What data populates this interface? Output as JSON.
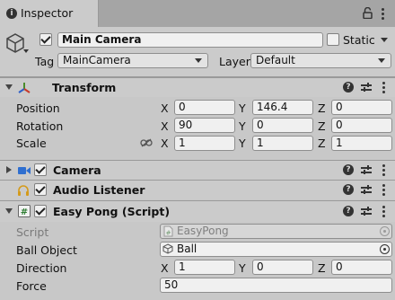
{
  "tab": {
    "label": "Inspector"
  },
  "object": {
    "name": "Main Camera",
    "active": true,
    "static_label": "Static",
    "static_checked": false,
    "tag_label": "Tag",
    "tag_value": "MainCamera",
    "layer_label": "Layer",
    "layer_value": "Default"
  },
  "transform": {
    "title": "Transform",
    "position": {
      "label": "Position",
      "x": "0",
      "y": "146.4",
      "z": "0"
    },
    "rotation": {
      "label": "Rotation",
      "x": "90",
      "y": "0",
      "z": "0"
    },
    "scale": {
      "label": "Scale",
      "x": "1",
      "y": "1",
      "z": "1"
    }
  },
  "camera": {
    "title": "Camera",
    "enabled": true
  },
  "audio_listener": {
    "title": "Audio Listener",
    "enabled": true
  },
  "script": {
    "title": "Easy Pong (Script)",
    "enabled": true,
    "script_label": "Script",
    "script_value": "EasyPong",
    "ball_label": "Ball Object",
    "ball_value": "Ball",
    "direction": {
      "label": "Direction",
      "x": "1",
      "y": "0",
      "z": "0"
    },
    "force": {
      "label": "Force",
      "value": "50"
    }
  },
  "axes": {
    "x": "X",
    "y": "Y",
    "z": "Z"
  },
  "colors": {
    "panel": "#c8c8c8",
    "field": "#f0f0f0",
    "header": "#cbcbcb"
  }
}
